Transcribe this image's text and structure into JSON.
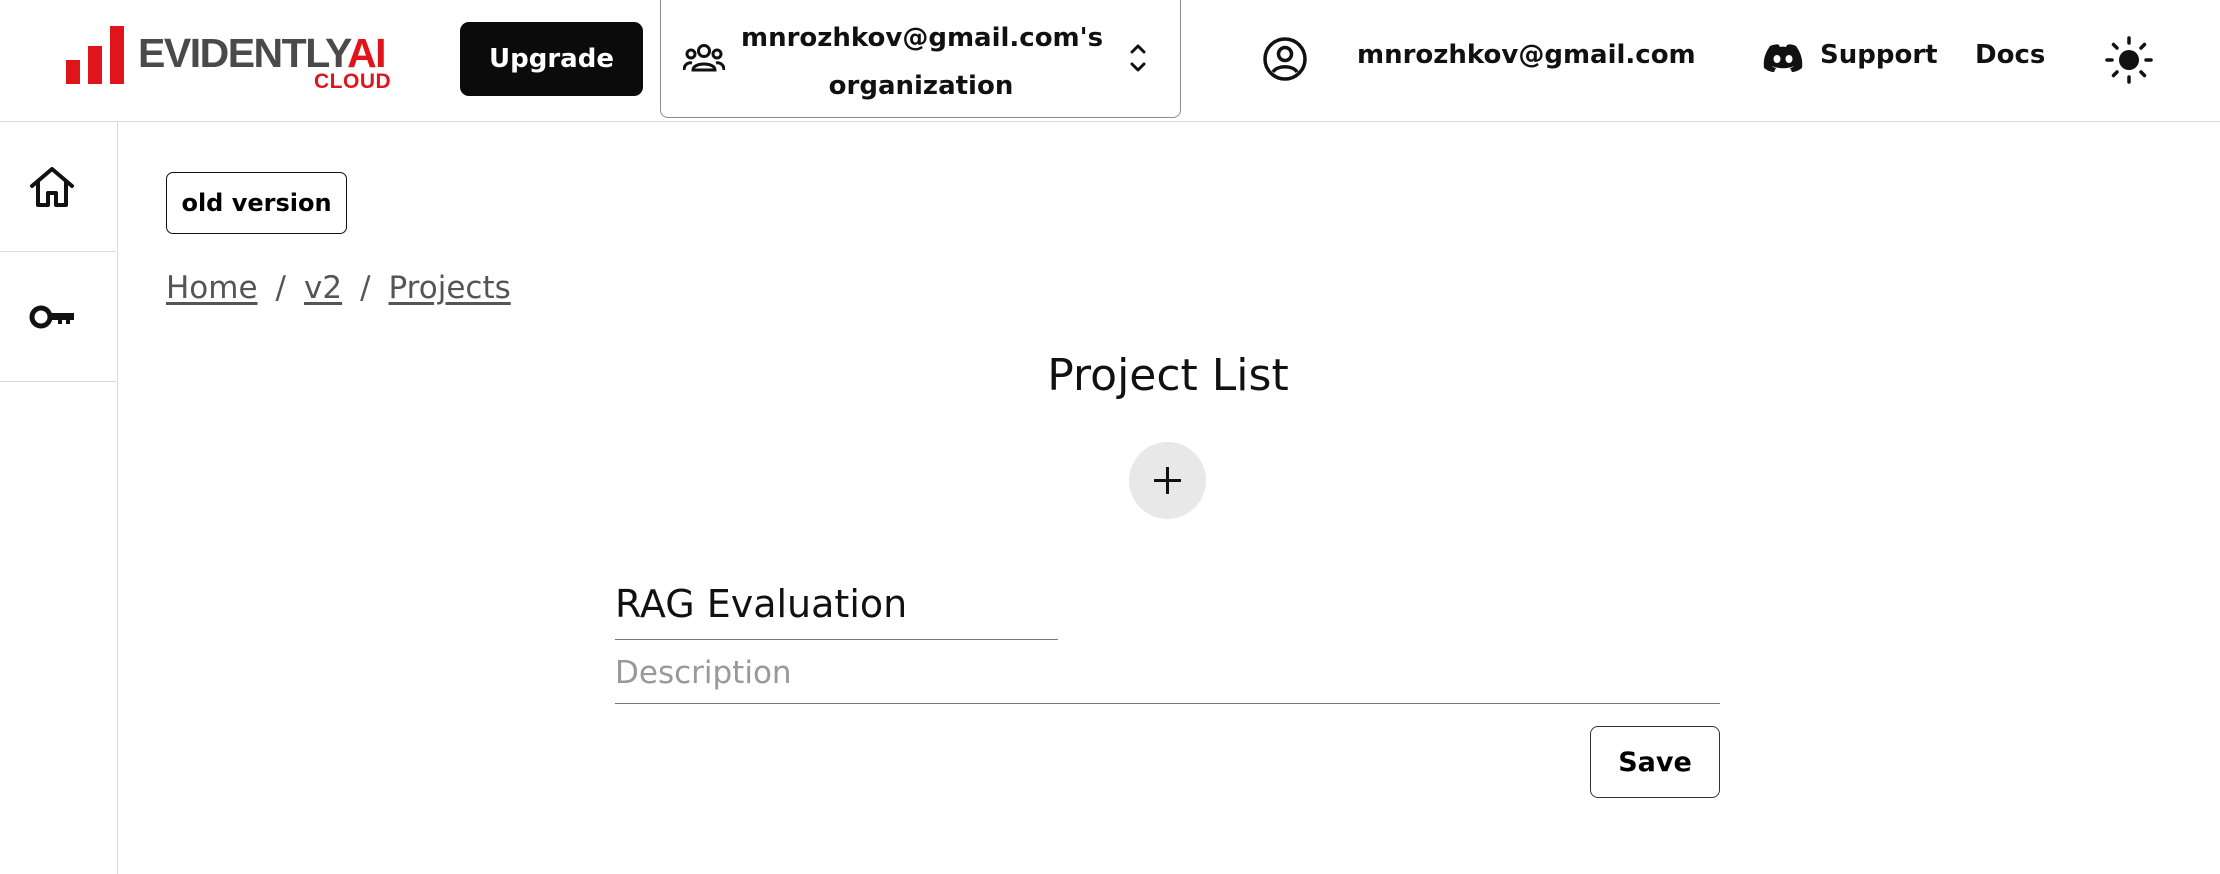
{
  "header": {
    "logo_text": "EVIDENTLY",
    "logo_ai": "AI",
    "logo_cloud": "CLOUD",
    "upgrade_label": "Upgrade",
    "org_label": "mnrozhkov@gmail.com's organization",
    "account_email": "mnrozhkov@gmail.com",
    "support_label": "Support",
    "docs_label": "Docs",
    "icons": [
      "group-icon",
      "chevron-up-down-icon",
      "account-circle-icon",
      "discord-icon",
      "sun-icon"
    ]
  },
  "sidebar": {
    "items": [
      {
        "icon": "home-icon"
      },
      {
        "icon": "key-icon"
      }
    ]
  },
  "main": {
    "old_version_label": "old version",
    "breadcrumb": [
      "Home",
      "v2",
      "Projects"
    ],
    "breadcrumb_separator": "/",
    "title": "Project List",
    "add_icon": "plus-icon",
    "project_name_value": "RAG Evaluation",
    "description_placeholder": "Description",
    "save_label": "Save"
  },
  "colors": {
    "brand_red": "#e0151c",
    "upgrade_bg": "#0b0b0b",
    "add_button_bg": "#e8e8e8"
  }
}
